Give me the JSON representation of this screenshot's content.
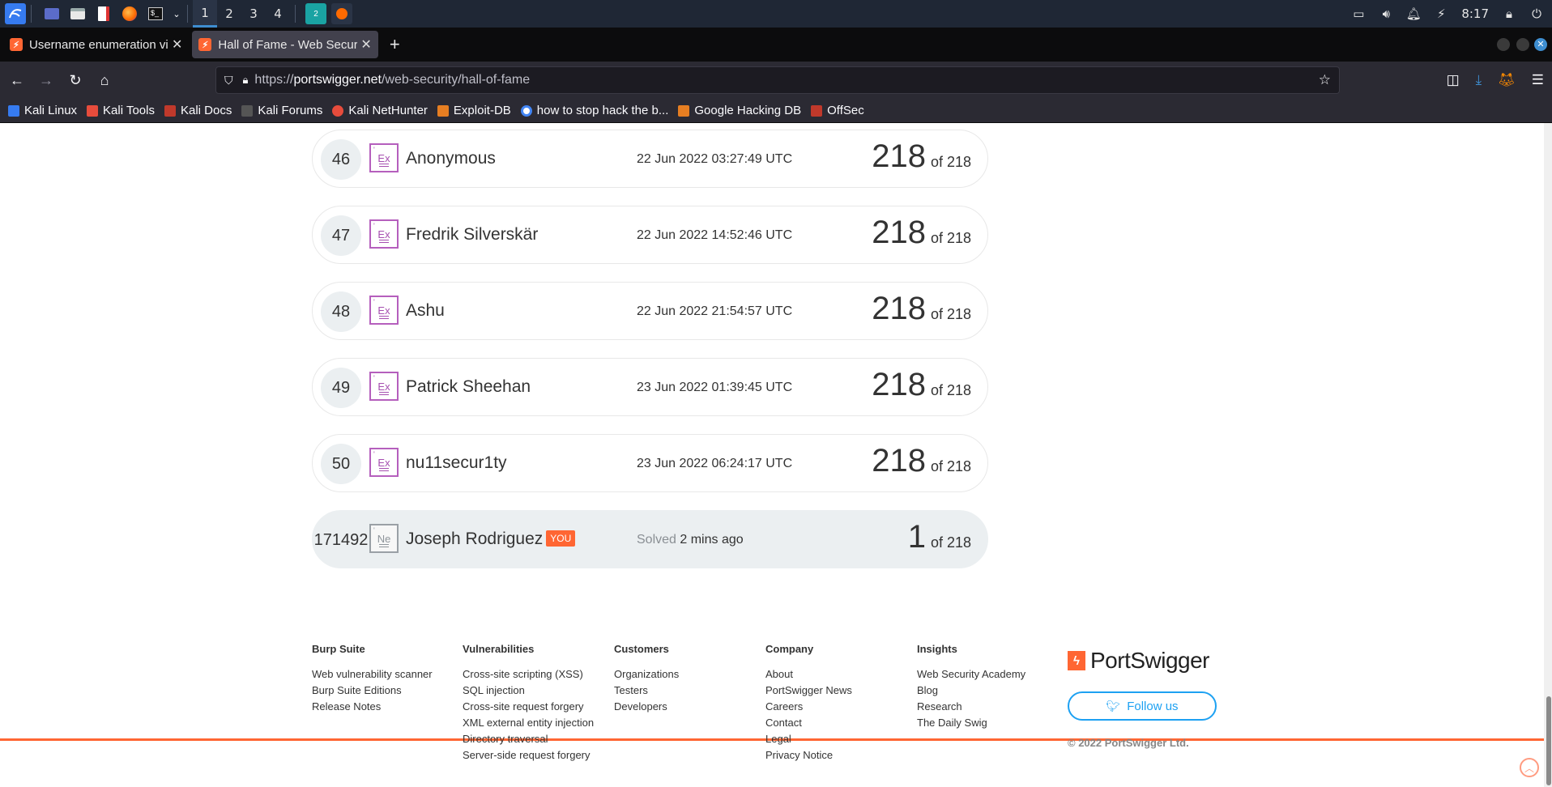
{
  "os_panel": {
    "workspaces": [
      "1",
      "2",
      "3",
      "4"
    ],
    "active_workspace": "1",
    "clock": "8:17"
  },
  "tabs": [
    {
      "title": "Username enumeration vi",
      "active": false
    },
    {
      "title": "Hall of Fame - Web Secur",
      "active": true
    }
  ],
  "url": {
    "prefix": "https://",
    "host": "portswigger.net",
    "path": "/web-security/hall-of-fame"
  },
  "bookmarks": [
    {
      "label": "Kali Linux",
      "color": "#367bf0"
    },
    {
      "label": "Kali Tools",
      "color": "#e74c3c"
    },
    {
      "label": "Kali Docs",
      "color": "#c0392b"
    },
    {
      "label": "Kali Forums",
      "color": "#2c3e50"
    },
    {
      "label": "Kali NetHunter",
      "color": "#e74c3c"
    },
    {
      "label": "Exploit-DB",
      "color": "#e67e22"
    },
    {
      "label": "how to stop hack the b...",
      "color": "#4285f4"
    },
    {
      "label": "Google Hacking DB",
      "color": "#e67e22"
    },
    {
      "label": "OffSec",
      "color": "#c0392b"
    }
  ],
  "hall_of_fame": [
    {
      "rank": "46",
      "level": "Ex",
      "name": "Anonymous",
      "time": "22 Jun 2022 03:27:49 UTC",
      "solved": "218",
      "of": "of 218"
    },
    {
      "rank": "47",
      "level": "Ex",
      "name": "Fredrik Silverskär",
      "time": "22 Jun 2022 14:52:46 UTC",
      "solved": "218",
      "of": "of 218"
    },
    {
      "rank": "48",
      "level": "Ex",
      "name": "Ashu",
      "time": "22 Jun 2022 21:54:57 UTC",
      "solved": "218",
      "of": "of 218"
    },
    {
      "rank": "49",
      "level": "Ex",
      "name": "Patrick Sheehan",
      "time": "23 Jun 2022 01:39:45 UTC",
      "solved": "218",
      "of": "of 218"
    },
    {
      "rank": "50",
      "level": "Ex",
      "name": "nu11secur1ty",
      "time": "23 Jun 2022 06:24:17 UTC",
      "solved": "218",
      "of": "of 218"
    }
  ],
  "you_row": {
    "rank": "171492",
    "level": "Ne",
    "name": "Joseph Rodriguez",
    "badge": "YOU",
    "solved_prefix": "Solved",
    "solved_ago": "2 mins ago",
    "solved": "1",
    "of": "of 218"
  },
  "footer": {
    "columns": [
      {
        "heading": "Burp Suite",
        "links": [
          "Web vulnerability scanner",
          "Burp Suite Editions",
          "Release Notes"
        ]
      },
      {
        "heading": "Vulnerabilities",
        "links": [
          "Cross-site scripting (XSS)",
          "SQL injection",
          "Cross-site request forgery",
          "XML external entity injection",
          "Directory traversal",
          "Server-side request forgery"
        ]
      },
      {
        "heading": "Customers",
        "links": [
          "Organizations",
          "Testers",
          "Developers"
        ]
      },
      {
        "heading": "Company",
        "links": [
          "About",
          "PortSwigger News",
          "Careers",
          "Contact",
          "Legal",
          "Privacy Notice"
        ]
      },
      {
        "heading": "Insights",
        "links": [
          "Web Security Academy",
          "Blog",
          "Research",
          "The Daily Swig"
        ]
      }
    ],
    "brand": "PortSwigger",
    "follow_label": "Follow us",
    "copyright": "© 2022 PortSwigger Ltd."
  },
  "colors": {
    "accent": "#ff6633",
    "twitter": "#1da1f2",
    "expert_badge": "#a64fb0"
  }
}
